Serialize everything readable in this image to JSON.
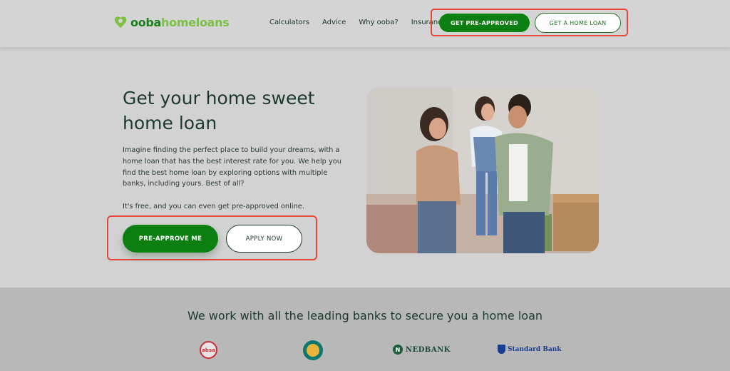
{
  "header": {
    "logo": {
      "part1": "ooba",
      "part2": "homeloans"
    },
    "nav": [
      "Calculators",
      "Advice",
      "Why ooba?",
      "Insurance"
    ],
    "get_preapproved_label": "GET PRE-APPROVED",
    "get_home_loan_label": "GET A HOME LOAN"
  },
  "hero": {
    "title": "Get your home sweet home loan",
    "paragraph1": "Imagine finding the perfect place to build your dreams, with a home loan that has the best interest rate for you. We help you find the best home loan by exploring options with multiple banks, including yours. Best of all?",
    "paragraph2": "It's free, and you can even get pre-approved online.",
    "preapprove_label": "PRE-APPROVE ME",
    "apply_label": "APPLY NOW"
  },
  "banks": {
    "title": "We work with all the leading banks to secure you a home loan",
    "absa": "absa",
    "nedbank": "NEDBANK",
    "standard_bank": "Standard Bank"
  },
  "colors": {
    "brand_green": "#0d7e12",
    "brand_light_green": "#7cc142",
    "highlight_red": "#e6483a"
  }
}
